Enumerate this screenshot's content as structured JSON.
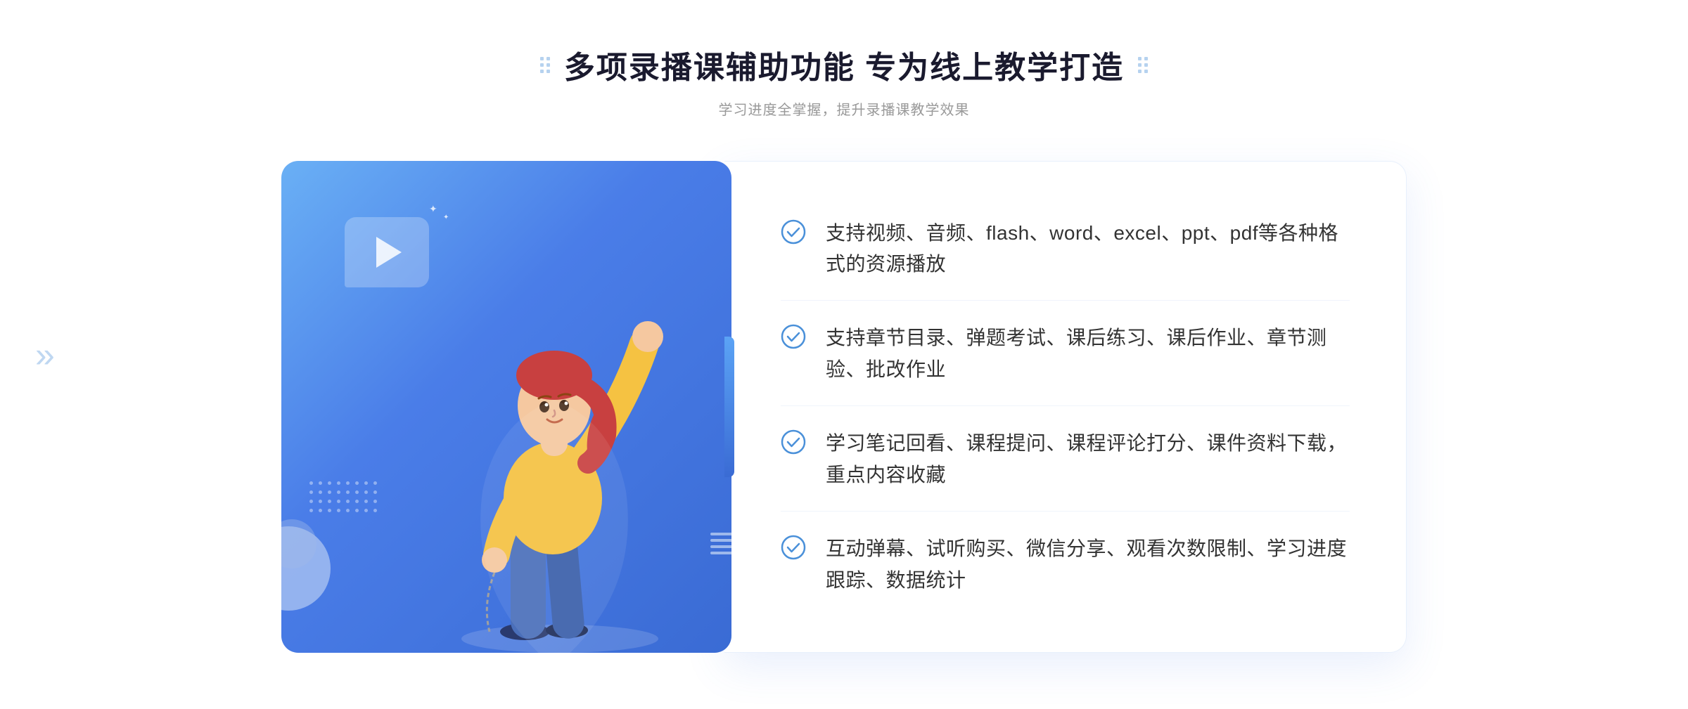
{
  "header": {
    "title": "多项录播课辅助功能 专为线上教学打造",
    "subtitle": "学习进度全掌握，提升录播课教学效果",
    "decoration_dots_count": 6
  },
  "features": [
    {
      "id": 1,
      "text": "支持视频、音频、flash、word、excel、ppt、pdf等各种格式的资源播放"
    },
    {
      "id": 2,
      "text": "支持章节目录、弹题考试、课后练习、课后作业、章节测验、批改作业"
    },
    {
      "id": 3,
      "text": "学习笔记回看、课程提问、课程评论打分、课件资料下载，重点内容收藏"
    },
    {
      "id": 4,
      "text": "互动弹幕、试听购买、微信分享、观看次数限制、学习进度跟踪、数据统计"
    }
  ],
  "colors": {
    "primary_blue": "#4a7de8",
    "light_blue": "#6ab0f5",
    "text_dark": "#333333",
    "text_gray": "#999999",
    "title_color": "#1a1a2e",
    "check_blue": "#4a90d9",
    "bg_white": "#ffffff"
  },
  "icons": {
    "play": "▶",
    "check": "✓",
    "chevron_right": "»",
    "chevron_left": "«"
  }
}
